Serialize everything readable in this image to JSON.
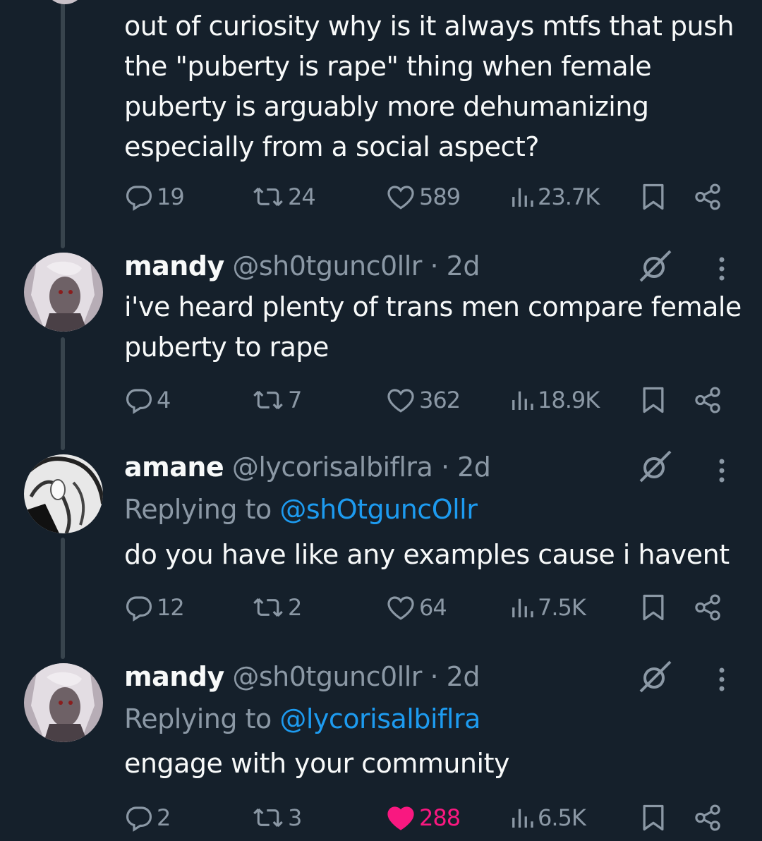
{
  "tweets": [
    {
      "body": "out of curiosity why is it always mtfs that push the \"puberty is rape\" thing when female puberty is arguably more dehumanizing especially from a social aspect?",
      "replies": "19",
      "reposts": "24",
      "likes": "589",
      "views": "23.7K",
      "liked": false
    },
    {
      "name": "mandy",
      "handle": "@sh0tgunc0llr",
      "time": "· 2d",
      "body": "i've heard plenty of trans men compare female puberty to rape",
      "replies": "4",
      "reposts": "7",
      "likes": "362",
      "views": "18.9K",
      "liked": false
    },
    {
      "name": "amane",
      "handle": "@lycorisalbiflra",
      "time": "· 2d",
      "replying_prefix": "Replying to",
      "replying_to": "@shOtguncOllr",
      "body": "do you have like any examples cause i havent",
      "replies": "12",
      "reposts": "2",
      "likes": "64",
      "views": "7.5K",
      "liked": false
    },
    {
      "name": "mandy",
      "handle": "@sh0tgunc0llr",
      "time": "· 2d",
      "replying_prefix": "Replying to",
      "replying_to": "@lycorisalbiflra",
      "body": "engage with your community",
      "replies": "2",
      "reposts": "3",
      "likes": "288",
      "views": "6.5K",
      "liked": true
    }
  ],
  "icons": {
    "reply": "reply-icon",
    "repost": "repost-icon",
    "like": "heart-icon",
    "views": "views-icon",
    "bookmark": "bookmark-icon",
    "share": "share-icon",
    "grok": "grok-icon",
    "more": "more-icon"
  },
  "colors": {
    "background": "#15202b",
    "muted": "#8b98a5",
    "link": "#1d9bf0",
    "like": "#f91880"
  }
}
